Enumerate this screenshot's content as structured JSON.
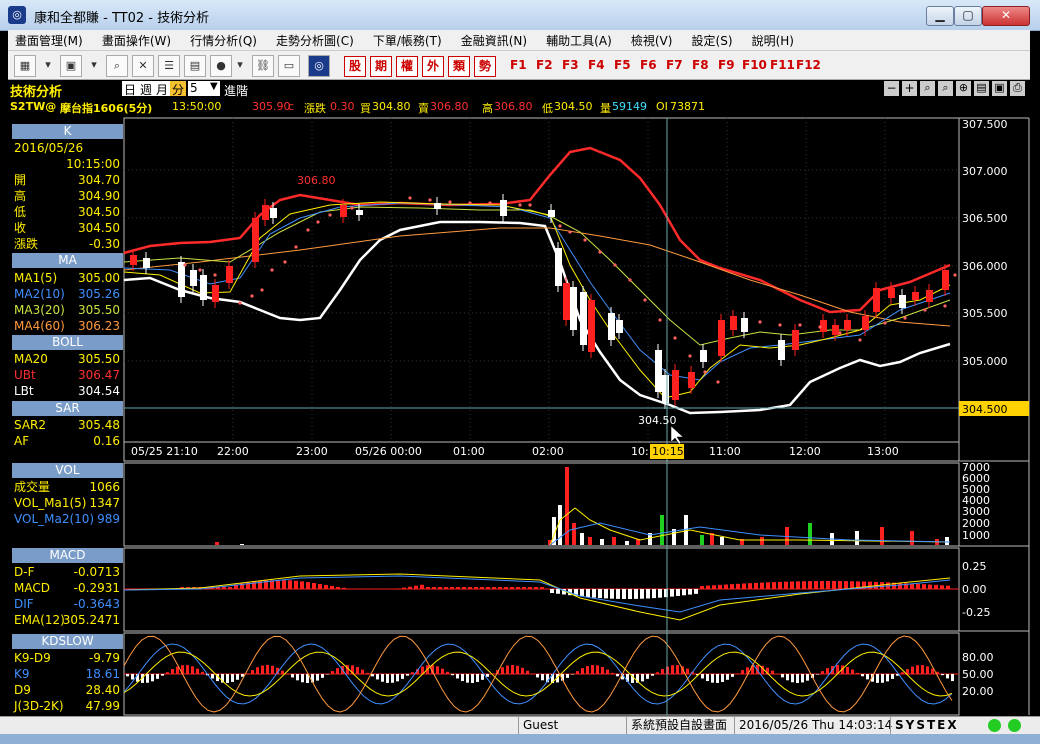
{
  "window": {
    "title": "康和全都賺 - TT02 - 技術分析"
  },
  "menu": [
    "畫面管理(M)",
    "畫面操作(W)",
    "行情分析(Q)",
    "走勢分析圖(C)",
    "下單/帳務(T)",
    "金融資訊(N)",
    "輔助工具(A)",
    "檢視(V)",
    "設定(S)",
    "說明(H)"
  ],
  "toolbar": {
    "red_buttons": [
      "股",
      "期",
      "權",
      "外",
      "類",
      "勢"
    ],
    "fkeys": [
      "F1",
      "F2",
      "F3",
      "F4",
      "F5",
      "F6",
      "F7",
      "F8",
      "F9",
      "F10",
      "F11",
      "F12"
    ]
  },
  "header": {
    "section": "技術分析",
    "periods": [
      "日",
      "週",
      "月",
      "分"
    ],
    "period_value": "5",
    "advanced": "進階",
    "symbol": "S2TW@",
    "name": "摩台指1606(5分)",
    "time": "13:50:00",
    "last": "305.90",
    "last_suffix": "c",
    "change_label": "漲跌",
    "change": "0.30",
    "bid_label": "買",
    "bid": "304.80",
    "ask_label": "賣",
    "ask": "306.80",
    "high_label": "高",
    "high": "306.80",
    "low_label": "低",
    "low": "304.50",
    "vol_label": "量",
    "vol": "59149",
    "oi_label": "OI",
    "oi": "73871"
  },
  "k_panel": {
    "title": "K",
    "date": "2016/05/26",
    "time": "10:15:00",
    "rows": [
      {
        "k": "開",
        "v": "304.70"
      },
      {
        "k": "高",
        "v": "304.90"
      },
      {
        "k": "低",
        "v": "304.50"
      },
      {
        "k": "收",
        "v": "304.50"
      },
      {
        "k": "漲跌",
        "v": "-0.30"
      }
    ]
  },
  "ma_panel": {
    "title": "MA",
    "rows": [
      {
        "k": "MA1(5)",
        "v": "305.00",
        "c": "#ffee00"
      },
      {
        "k": "MA2(10)",
        "v": "305.26",
        "c": "#3f8fff"
      },
      {
        "k": "MA3(20)",
        "v": "305.50",
        "c": "#cde040"
      },
      {
        "k": "MA4(60)",
        "v": "306.23",
        "c": "#ff9a3f"
      }
    ]
  },
  "boll_panel": {
    "title": "BOLL",
    "rows": [
      {
        "k": "MA20",
        "v": "305.50",
        "c": "#ffee00"
      },
      {
        "k": "UBt",
        "v": "306.47",
        "c": "#ff3030"
      },
      {
        "k": "LBt",
        "v": "304.54",
        "c": "#ffffff"
      }
    ]
  },
  "sar_panel": {
    "title": "SAR",
    "rows": [
      {
        "k": "SAR2",
        "v": "305.48",
        "c": "#ffee00"
      },
      {
        "k": "AF",
        "v": "0.16",
        "c": "#ffee00"
      }
    ]
  },
  "vol_panel": {
    "title": "VOL",
    "rows": [
      {
        "k": "成交量",
        "v": "1066",
        "c": "#ffee00"
      },
      {
        "k": "VOL_Ma1(5)",
        "v": "1347",
        "c": "#ffee00"
      },
      {
        "k": "VOL_Ma2(10)",
        "v": "989",
        "c": "#3f8fff"
      }
    ]
  },
  "macd_panel": {
    "title": "MACD",
    "rows": [
      {
        "k": "D-F",
        "v": "-0.0713",
        "c": "#ffee00"
      },
      {
        "k": "MACD",
        "v": "-0.2931",
        "c": "#ffee00"
      },
      {
        "k": "DIF",
        "v": "-0.3643",
        "c": "#3f8fff"
      },
      {
        "k": "EMA(12)",
        "v": "305.2471",
        "c": "#ffee00"
      }
    ]
  },
  "kd_panel": {
    "title": "KDSLOW",
    "rows": [
      {
        "k": "K9-D9",
        "v": "-9.79",
        "c": "#ffee00"
      },
      {
        "k": "K9",
        "v": "18.61",
        "c": "#3f8fff"
      },
      {
        "k": "D9",
        "v": "28.40",
        "c": "#ffee00"
      },
      {
        "k": "J(3D-2K)",
        "v": "47.99",
        "c": "#ffee00"
      }
    ]
  },
  "chart": {
    "price_ticks": [
      "307.000",
      "306.500",
      "306.000",
      "305.500",
      "305.000"
    ],
    "top_partial": "307.500",
    "current_price": "304.500",
    "time_labels": [
      "05/25 21:10",
      "22:00",
      "23:00",
      "05/26 00:00",
      "01:00",
      "02:00",
      "10:",
      "11:00",
      "12:00",
      "13:00"
    ],
    "cursor_time": "10:15",
    "high_annot": "306.80",
    "low_annot": "304.50",
    "vol_ticks": [
      "7000",
      "6000",
      "5000",
      "4000",
      "3000",
      "2000",
      "1000"
    ],
    "macd_ticks": [
      "0.25",
      "0.00",
      "-0.25"
    ],
    "kd_ticks": [
      "80.00",
      "50.00",
      "20.00"
    ]
  },
  "status": {
    "user": "Guest",
    "layout": "系統預設自設畫面",
    "datetime": "2016/05/26 Thu 14:03:14",
    "brand": "SYSTEX"
  },
  "colors": {
    "up": "#ff2020",
    "down": "#ffffff",
    "green": "#20d020",
    "panel_title": "#7a9cc8"
  }
}
